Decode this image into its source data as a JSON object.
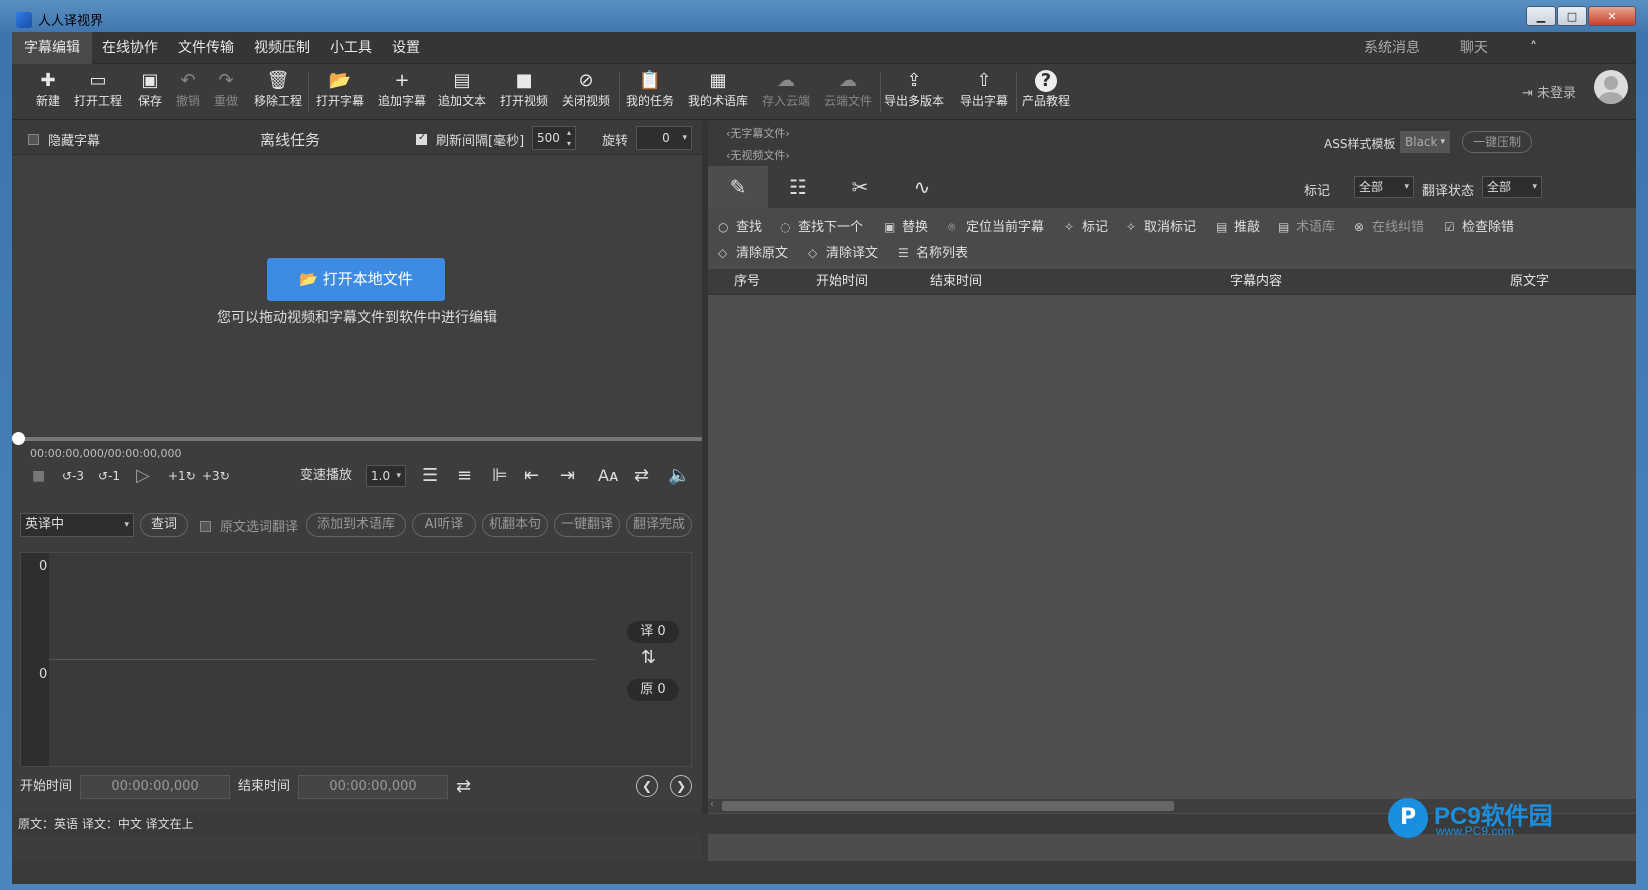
{
  "window": {
    "title": "人人译视界"
  },
  "menu": {
    "items": [
      "字幕编辑",
      "在线协作",
      "文件传输",
      "视频压制",
      "小工具",
      "设置"
    ],
    "system_msg": "系统消息",
    "chat": "聊天",
    "collapse": "˄"
  },
  "toolbar": {
    "new": "新建",
    "open_project": "打开工程",
    "save": "保存",
    "undo": "撤销",
    "redo": "重做",
    "remove_project": "移除工程",
    "open_subtitle": "打开字幕",
    "append_subtitle": "追加字幕",
    "append_text": "追加文本",
    "open_video": "打开视频",
    "close_video": "关闭视频",
    "my_tasks": "我的任务",
    "my_glossary": "我的术语库",
    "save_cloud": "存入云端",
    "cloud_files": "云端文件",
    "export_multi": "导出多版本",
    "export_subtitle": "导出字幕",
    "tutorial": "产品教程",
    "login": "未登录"
  },
  "left": {
    "hide_subtitle": "隐藏字幕",
    "offline_tasks": "离线任务",
    "refresh_label": "刷新间隔[毫秒]",
    "refresh_value": "500",
    "rotate_label": "旋转",
    "rotate_value": "0",
    "open_local": "打开本地文件",
    "hint": "您可以拖动视频和字幕文件到软件中进行编辑",
    "timecode": "00:00:00,000/00:00:00,000",
    "speed_label": "变速播放",
    "speed_value": "1.0",
    "skip_back3": "-3",
    "skip_back1": "-1",
    "skip_fwd1": "+1",
    "skip_fwd3": "+3",
    "lang_mode": "英译中",
    "lookup": "查词",
    "source_select": "原文选词翻译",
    "add_glossary": "添加到术语库",
    "ai_listen": "AI听译",
    "machine_translate": "机翻本句",
    "one_click": "一键翻译",
    "done": "翻译完成",
    "gutter_top": "0",
    "gutter_bottom": "0",
    "trans_badge": "译 0",
    "orig_badge": "原 0",
    "start_label": "开始时间",
    "start_value": "00:00:00,000",
    "end_label": "结束时间",
    "end_value": "00:00:00,000"
  },
  "right": {
    "no_subtitle": "‹无字幕文件›",
    "no_video": "‹无视频文件›",
    "ass_label": "ASS样式模板",
    "ass_value": "Black",
    "one_click_burn": "一键压制",
    "mark_label": "标记",
    "mark_value": "全部",
    "trans_state_label": "翻译状态",
    "trans_state_value": "全部",
    "tools": {
      "find": "查找",
      "find_next": "查找下一个",
      "replace": "替换",
      "locate": "定位当前字幕",
      "mark": "标记",
      "unmark": "取消标记",
      "review": "推敲",
      "glossary": "术语库",
      "online_check": "在线纠错",
      "check_errors": "检查除错",
      "clear_source": "清除原文",
      "clear_trans": "清除译文",
      "name_list": "名称列表"
    },
    "columns": [
      "序号",
      "开始时间",
      "结束时间",
      "字幕内容",
      "原文字"
    ]
  },
  "status": {
    "text": "原文：英语 译文：中文   译文在上"
  },
  "watermark": {
    "brand": "PC9软件园",
    "url": "www.PC9.com",
    "logo_letter": "P"
  }
}
